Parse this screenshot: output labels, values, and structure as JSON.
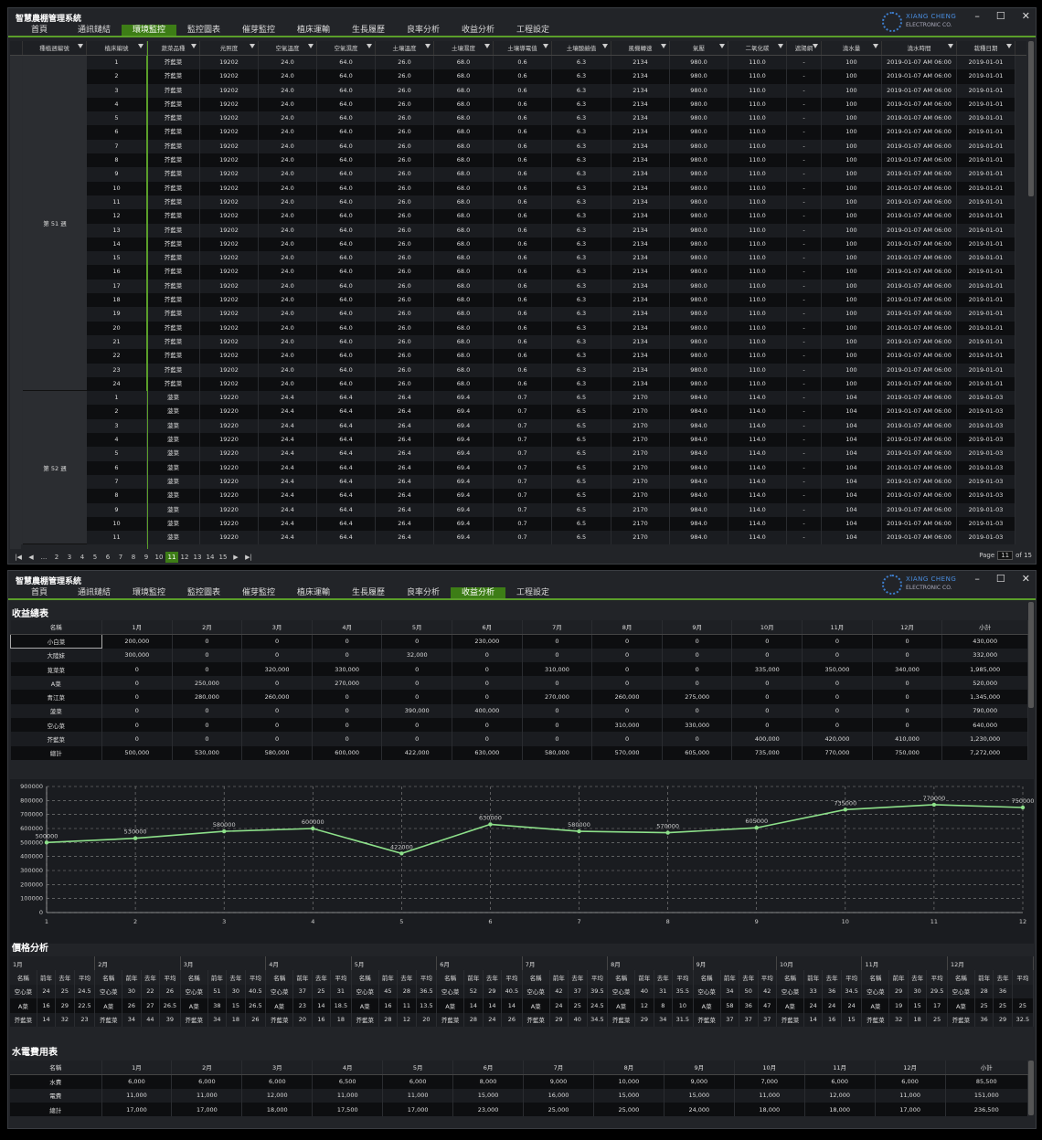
{
  "window1": {
    "title": "智慧農棚管理系統",
    "logo": {
      "line1": "XIANG CHENG",
      "line2": "ELECTRONIC CO."
    },
    "controls": [
      "–",
      "☐",
      "✕"
    ],
    "menu": [
      "首頁",
      "通訊鏈結",
      "環境監控",
      "監控圖表",
      "催芽監控",
      "植床運輸",
      "生長履歷",
      "良率分析",
      "收益分析",
      "工程設定"
    ],
    "active_menu": "環境監控",
    "columns": [
      "種植週編號",
      "植床編號",
      "蔬菜品種",
      "光照度",
      "空氣溫度",
      "空氣濕度",
      "土壤溫度",
      "土壤濕度",
      "土壤導電值",
      "土壤酸鹼值",
      "風機轉速",
      "氣壓",
      "二氧化碳",
      "遮陽網",
      "澆水量",
      "澆水時間",
      "栽種日期"
    ],
    "groups": [
      {
        "label": "第 51 週",
        "beds": [
          "1",
          "2",
          "3",
          "4",
          "5",
          "6",
          "7",
          "8",
          "9",
          "10",
          "11",
          "12",
          "13",
          "14",
          "15",
          "16",
          "17",
          "18",
          "19",
          "20",
          "21",
          "22",
          "23",
          "24"
        ],
        "values": [
          "芥藍菜",
          "19202",
          "24.0",
          "64.0",
          "26.0",
          "68.0",
          "0.6",
          "6.3",
          "2134",
          "980.0",
          "110.0",
          "-",
          "100",
          "2019-01-07 AM 06:00",
          "2019-01-01"
        ]
      },
      {
        "label": "第 52 週",
        "beds": [
          "1",
          "2",
          "3",
          "4",
          "5",
          "6",
          "7",
          "8",
          "9",
          "10",
          "11"
        ],
        "values": [
          "菠菜",
          "19220",
          "24.4",
          "64.4",
          "26.4",
          "69.4",
          "0.7",
          "6.5",
          "2170",
          "984.0",
          "114.0",
          "-",
          "104",
          "2019-01-07 AM 06:00",
          "2019-01-03"
        ]
      }
    ],
    "pager": {
      "nav_first": "|◀",
      "nav_prev": "◀",
      "pages": [
        "...",
        "2",
        "3",
        "4",
        "5",
        "6",
        "7",
        "8",
        "9",
        "10",
        "11",
        "12",
        "13",
        "14",
        "15"
      ],
      "active": "11",
      "nav_next": "▶",
      "nav_last": "▶|",
      "label": "Page",
      "current": "11",
      "of": "of 15"
    }
  },
  "window2": {
    "title": "智慧農棚管理系統",
    "logo": {
      "line1": "XIANG CHENG",
      "line2": "ELECTRONIC CO."
    },
    "controls": [
      "–",
      "☐",
      "✕"
    ],
    "menu": [
      "首頁",
      "通訊鏈結",
      "環境監控",
      "監控圖表",
      "催芽監控",
      "植床運輸",
      "生長履歷",
      "良率分析",
      "收益分析",
      "工程設定"
    ],
    "active_menu": "收益分析",
    "revenue": {
      "title": "收益總表",
      "headers": [
        "名稱",
        "1月",
        "2月",
        "3月",
        "4月",
        "5月",
        "6月",
        "7月",
        "8月",
        "9月",
        "10月",
        "11月",
        "12月",
        "小計"
      ],
      "rows": [
        [
          "小白菜",
          "200,000",
          "0",
          "0",
          "0",
          "0",
          "230,000",
          "0",
          "0",
          "0",
          "0",
          "0",
          "0",
          "430,000"
        ],
        [
          "大陸妹",
          "300,000",
          "0",
          "0",
          "0",
          "32,000",
          "0",
          "0",
          "0",
          "0",
          "0",
          "0",
          "0",
          "332,000"
        ],
        [
          "莧菜菜",
          "0",
          "0",
          "320,000",
          "330,000",
          "0",
          "0",
          "310,000",
          "0",
          "0",
          "335,000",
          "350,000",
          "340,000",
          "1,985,000"
        ],
        [
          "A菜",
          "0",
          "250,000",
          "0",
          "270,000",
          "0",
          "0",
          "0",
          "0",
          "0",
          "0",
          "0",
          "0",
          "520,000"
        ],
        [
          "青江菜",
          "0",
          "280,000",
          "260,000",
          "0",
          "0",
          "0",
          "270,000",
          "260,000",
          "275,000",
          "0",
          "0",
          "0",
          "1,345,000"
        ],
        [
          "菠菜",
          "0",
          "0",
          "0",
          "0",
          "390,000",
          "400,000",
          "0",
          "0",
          "0",
          "0",
          "0",
          "0",
          "790,000"
        ],
        [
          "空心菜",
          "0",
          "0",
          "0",
          "0",
          "0",
          "0",
          "0",
          "310,000",
          "330,000",
          "0",
          "0",
          "0",
          "640,000"
        ],
        [
          "芥藍菜",
          "0",
          "0",
          "0",
          "0",
          "0",
          "0",
          "0",
          "0",
          "0",
          "400,000",
          "420,000",
          "410,000",
          "1,230,000"
        ],
        [
          "總計",
          "500,000",
          "530,000",
          "580,000",
          "600,000",
          "422,000",
          "630,000",
          "580,000",
          "570,000",
          "605,000",
          "735,000",
          "770,000",
          "750,000",
          "7,272,000"
        ]
      ]
    },
    "chart_data": {
      "type": "line",
      "x": [
        1,
        2,
        3,
        4,
        5,
        6,
        7,
        8,
        9,
        10,
        11,
        12
      ],
      "series": [
        {
          "values": [
            500000,
            530000,
            580000,
            600000,
            422000,
            630000,
            580000,
            570000,
            605000,
            735000,
            770000,
            750000
          ]
        }
      ],
      "point_labels": [
        "500000",
        "530000",
        "580000",
        "600000",
        "422000",
        "630000",
        "580000",
        "570000",
        "605000",
        "735000",
        "770000",
        "750000"
      ],
      "y_ticks": [
        "0",
        "100000",
        "200000",
        "300000",
        "400000",
        "500000",
        "600000",
        "700000",
        "800000",
        "900000"
      ],
      "x_ticks": [
        "1",
        "2",
        "3",
        "4",
        "5",
        "6",
        "7",
        "8",
        "9",
        "10",
        "11",
        "12"
      ],
      "ylim": [
        0,
        900000
      ],
      "xlim": [
        1,
        12
      ],
      "grid": true,
      "line_color": "#8de08a"
    },
    "price": {
      "title": "價格分析",
      "months": [
        "1月",
        "2月",
        "3月",
        "4月",
        "5月",
        "6月",
        "7月",
        "8月",
        "9月",
        "10月",
        "11月",
        "12月"
      ],
      "sub": [
        "名稱",
        "前年",
        "去年",
        "平均"
      ],
      "data": [
        [
          [
            "空心菜",
            "24",
            "25",
            "24.5"
          ],
          [
            "空心菜",
            "30",
            "22",
            "26"
          ],
          [
            "空心菜",
            "51",
            "30",
            "40.5"
          ],
          [
            "空心菜",
            "37",
            "25",
            "31"
          ],
          [
            "空心菜",
            "45",
            "28",
            "36.5"
          ],
          [
            "空心菜",
            "52",
            "29",
            "40.5"
          ],
          [
            "空心菜",
            "42",
            "37",
            "39.5"
          ],
          [
            "空心菜",
            "40",
            "31",
            "35.5"
          ],
          [
            "空心菜",
            "34",
            "50",
            "42"
          ],
          [
            "空心菜",
            "33",
            "36",
            "34.5"
          ],
          [
            "空心菜",
            "29",
            "30",
            "29.5"
          ],
          [
            "空心菜",
            "28",
            "36",
            ""
          ]
        ],
        [
          [
            "A菜",
            "16",
            "29",
            "22.5"
          ],
          [
            "A菜",
            "26",
            "27",
            "26.5"
          ],
          [
            "A菜",
            "38",
            "15",
            "26.5"
          ],
          [
            "A菜",
            "23",
            "14",
            "18.5"
          ],
          [
            "A菜",
            "16",
            "11",
            "13.5"
          ],
          [
            "A菜",
            "14",
            "14",
            "14"
          ],
          [
            "A菜",
            "24",
            "25",
            "24.5"
          ],
          [
            "A菜",
            "12",
            "8",
            "10"
          ],
          [
            "A菜",
            "58",
            "36",
            "47"
          ],
          [
            "A菜",
            "24",
            "24",
            "24"
          ],
          [
            "A菜",
            "19",
            "15",
            "17"
          ],
          [
            "A菜",
            "25",
            "25",
            "25"
          ]
        ],
        [
          [
            "芥藍菜",
            "14",
            "32",
            "23"
          ],
          [
            "芥藍菜",
            "34",
            "44",
            "39"
          ],
          [
            "芥藍菜",
            "34",
            "18",
            "26"
          ],
          [
            "芥藍菜",
            "20",
            "16",
            "18"
          ],
          [
            "芥藍菜",
            "28",
            "12",
            "20"
          ],
          [
            "芥藍菜",
            "28",
            "24",
            "26"
          ],
          [
            "芥藍菜",
            "29",
            "40",
            "34.5"
          ],
          [
            "芥藍菜",
            "29",
            "34",
            "31.5"
          ],
          [
            "芥藍菜",
            "37",
            "37",
            "37"
          ],
          [
            "芥藍菜",
            "14",
            "16",
            "15"
          ],
          [
            "芥藍菜",
            "32",
            "18",
            "25"
          ],
          [
            "芥藍菜",
            "36",
            "29",
            "32.5"
          ]
        ]
      ]
    },
    "utility": {
      "title": "水電費用表",
      "headers": [
        "名稱",
        "1月",
        "2月",
        "3月",
        "4月",
        "5月",
        "6月",
        "7月",
        "8月",
        "9月",
        "10月",
        "11月",
        "12月",
        "小計"
      ],
      "rows": [
        [
          "水費",
          "6,000",
          "6,000",
          "6,000",
          "6,500",
          "6,000",
          "8,000",
          "9,000",
          "10,000",
          "9,000",
          "7,000",
          "6,000",
          "6,000",
          "85,500"
        ],
        [
          "電費",
          "11,000",
          "11,000",
          "12,000",
          "11,000",
          "11,000",
          "15,000",
          "16,000",
          "15,000",
          "15,000",
          "11,000",
          "12,000",
          "11,000",
          "151,000"
        ],
        [
          "總計",
          "17,000",
          "17,000",
          "18,000",
          "17,500",
          "17,000",
          "23,000",
          "25,000",
          "25,000",
          "24,000",
          "18,000",
          "18,000",
          "17,000",
          "236,500"
        ]
      ]
    }
  }
}
